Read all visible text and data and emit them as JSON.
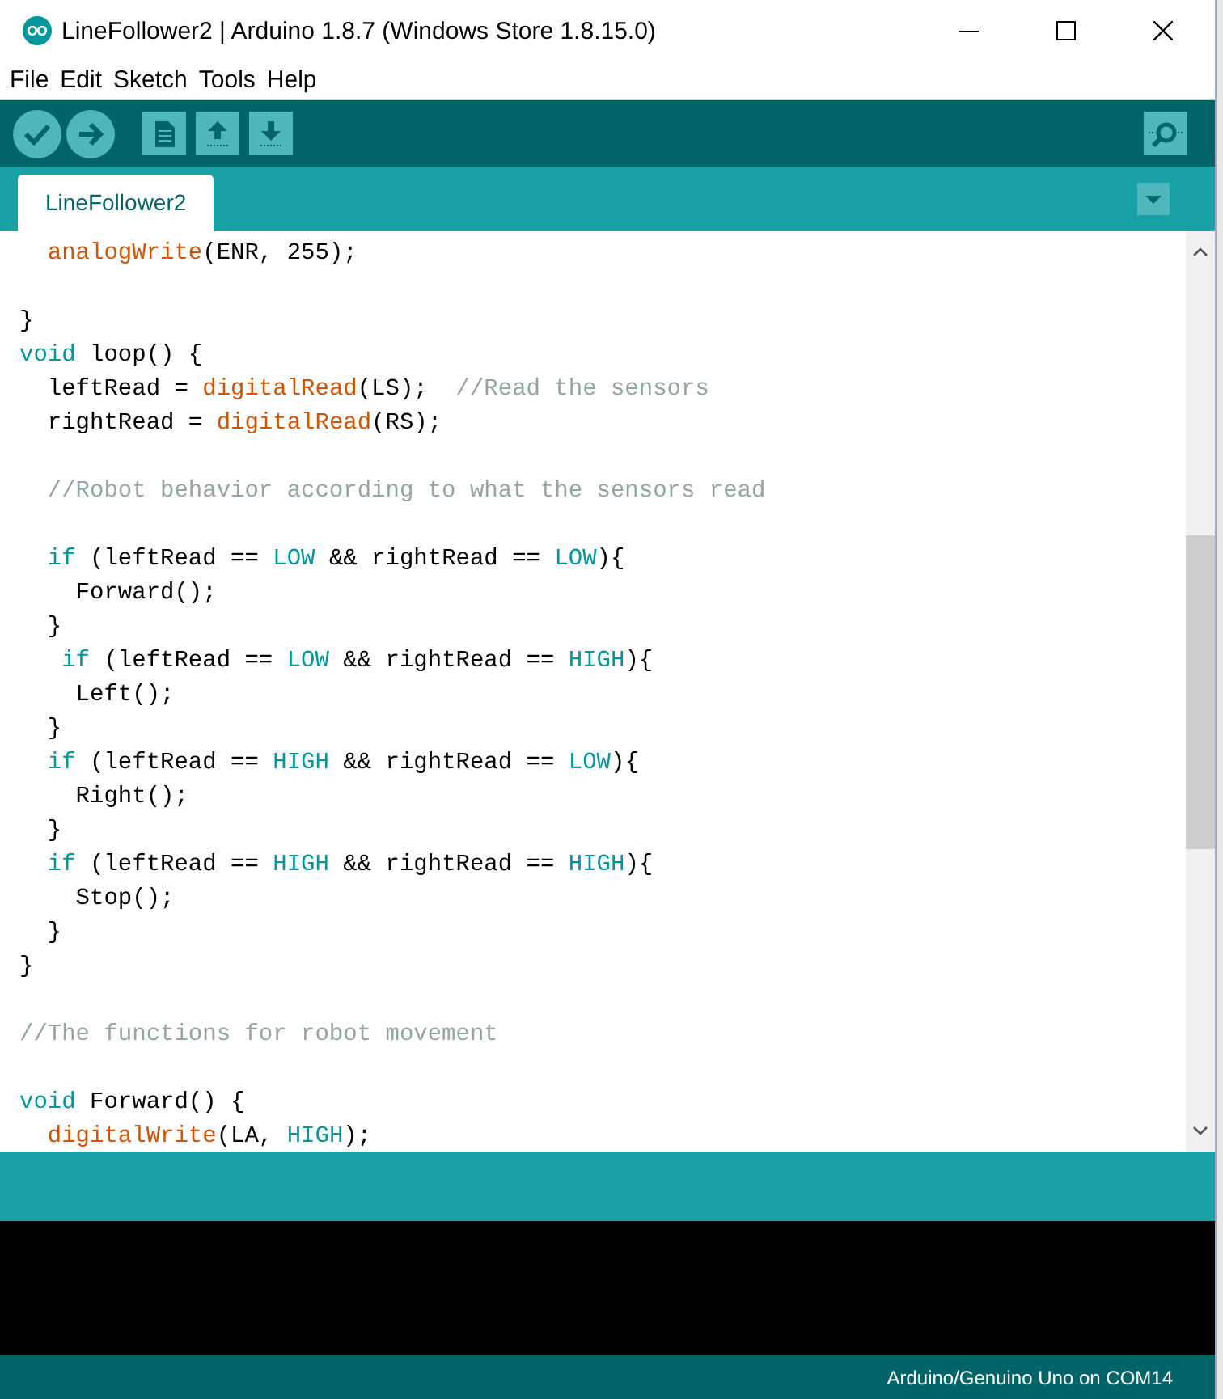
{
  "window": {
    "title": "LineFollower2 | Arduino 1.8.7 (Windows Store 1.8.15.0)"
  },
  "menu": [
    "File",
    "Edit",
    "Sketch",
    "Tools",
    "Help"
  ],
  "toolbar": [
    {
      "kind": "verify"
    },
    {
      "kind": "upload"
    },
    {
      "kind": "new"
    },
    {
      "kind": "open"
    },
    {
      "kind": "save"
    }
  ],
  "tabs": [
    {
      "label": "LineFollower2",
      "selected": true
    }
  ],
  "editor": {
    "lines": [
      {
        "kind": "code",
        "tokens": [
          {
            "text": "  analogWrite",
            "kind": "function"
          },
          {
            "text": "(ENR, 255);",
            "kind": "plain"
          }
        ]
      },
      {
        "kind": "blank"
      },
      {
        "kind": "code",
        "tokens": [
          {
            "text": "}",
            "kind": "plain"
          }
        ]
      },
      {
        "kind": "code",
        "tokens": [
          {
            "text": "void",
            "kind": "keyword"
          },
          {
            "text": " loop() {",
            "kind": "plain"
          }
        ]
      },
      {
        "kind": "code",
        "tokens": [
          {
            "text": "  leftRead = ",
            "kind": "plain"
          },
          {
            "text": "digitalRead",
            "kind": "function"
          },
          {
            "text": "(LS);  ",
            "kind": "plain"
          },
          {
            "text": "//Read the sensors",
            "kind": "comment"
          }
        ]
      },
      {
        "kind": "code",
        "tokens": [
          {
            "text": "  rightRead = ",
            "kind": "plain"
          },
          {
            "text": "digitalRead",
            "kind": "function"
          },
          {
            "text": "(RS);",
            "kind": "plain"
          }
        ]
      },
      {
        "kind": "blank"
      },
      {
        "kind": "code",
        "tokens": [
          {
            "text": "  //Robot behavior according to what the sensors read",
            "kind": "comment"
          }
        ]
      },
      {
        "kind": "blank"
      },
      {
        "kind": "code",
        "tokens": [
          {
            "text": "  if",
            "kind": "keyword"
          },
          {
            "text": " (leftRead == ",
            "kind": "plain"
          },
          {
            "text": "LOW",
            "kind": "constant"
          },
          {
            "text": " && rightRead == ",
            "kind": "plain"
          },
          {
            "text": "LOW",
            "kind": "constant"
          },
          {
            "text": "){",
            "kind": "plain"
          }
        ]
      },
      {
        "kind": "code",
        "tokens": [
          {
            "text": "    Forward();",
            "kind": "plain"
          }
        ]
      },
      {
        "kind": "code",
        "tokens": [
          {
            "text": "  }",
            "kind": "plain"
          }
        ]
      },
      {
        "kind": "code",
        "tokens": [
          {
            "text": "   if",
            "kind": "keyword"
          },
          {
            "text": " (leftRead == ",
            "kind": "plain"
          },
          {
            "text": "LOW",
            "kind": "constant"
          },
          {
            "text": " && rightRead == ",
            "kind": "plain"
          },
          {
            "text": "HIGH",
            "kind": "constant"
          },
          {
            "text": "){",
            "kind": "plain"
          }
        ]
      },
      {
        "kind": "code",
        "tokens": [
          {
            "text": "    Left();",
            "kind": "plain"
          }
        ]
      },
      {
        "kind": "code",
        "tokens": [
          {
            "text": "  }",
            "kind": "plain"
          }
        ]
      },
      {
        "kind": "code",
        "tokens": [
          {
            "text": "  if",
            "kind": "keyword"
          },
          {
            "text": " (leftRead == ",
            "kind": "plain"
          },
          {
            "text": "HIGH",
            "kind": "constant"
          },
          {
            "text": " && rightRead == ",
            "kind": "plain"
          },
          {
            "text": "LOW",
            "kind": "constant"
          },
          {
            "text": "){",
            "kind": "plain"
          }
        ]
      },
      {
        "kind": "code",
        "tokens": [
          {
            "text": "    Right();",
            "kind": "plain"
          }
        ]
      },
      {
        "kind": "code",
        "tokens": [
          {
            "text": "  }",
            "kind": "plain"
          }
        ]
      },
      {
        "kind": "code",
        "tokens": [
          {
            "text": "  if",
            "kind": "keyword"
          },
          {
            "text": " (leftRead == ",
            "kind": "plain"
          },
          {
            "text": "HIGH",
            "kind": "constant"
          },
          {
            "text": " && rightRead == ",
            "kind": "plain"
          },
          {
            "text": "HIGH",
            "kind": "constant"
          },
          {
            "text": "){",
            "kind": "plain"
          }
        ]
      },
      {
        "kind": "code",
        "tokens": [
          {
            "text": "    Stop();",
            "kind": "plain"
          }
        ]
      },
      {
        "kind": "code",
        "tokens": [
          {
            "text": "  }",
            "kind": "plain"
          }
        ]
      },
      {
        "kind": "code",
        "tokens": [
          {
            "text": "}",
            "kind": "plain"
          }
        ]
      },
      {
        "kind": "blank"
      },
      {
        "kind": "code",
        "tokens": [
          {
            "text": "//The functions for robot movement",
            "kind": "comment"
          }
        ]
      },
      {
        "kind": "blank"
      },
      {
        "kind": "code",
        "tokens": [
          {
            "text": "void",
            "kind": "keyword"
          },
          {
            "text": " Forward() {",
            "kind": "plain"
          }
        ]
      },
      {
        "kind": "code",
        "tokens": [
          {
            "text": "  digitalWrite",
            "kind": "function"
          },
          {
            "text": "(LA, ",
            "kind": "plain"
          },
          {
            "text": "HIGH",
            "kind": "constant"
          },
          {
            "text": ");",
            "kind": "plain"
          }
        ]
      }
    ]
  },
  "status_bar": {
    "board": "Arduino/Genuino Uno on COM14"
  }
}
